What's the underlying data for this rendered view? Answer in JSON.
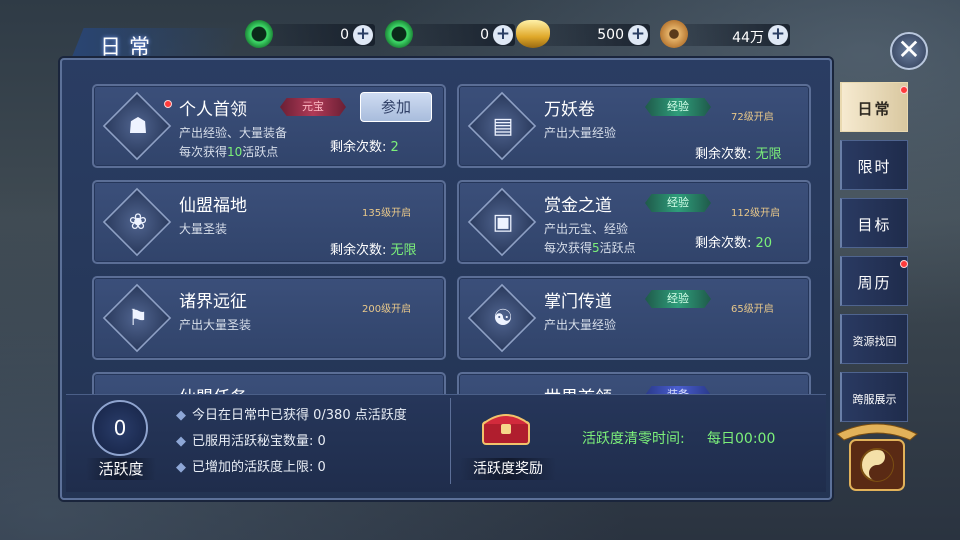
{
  "topbar": {
    "res1": {
      "value": "0",
      "icon": "green-swirl-icon"
    },
    "res2": {
      "value": "0",
      "icon": "green-swirl-icon"
    },
    "res3": {
      "value": "500",
      "icon": "gold-ingot-icon"
    },
    "res4": {
      "value": "44万",
      "icon": "copper-coin-icon"
    },
    "plus": "+"
  },
  "title": "日常",
  "close": "✕",
  "cards": [
    {
      "name": "个人首领",
      "tag": "元宝",
      "tag_color": "#b03a57",
      "desc1": "产出经验、大量装备",
      "desc2_pre": "每次获得",
      "desc2_num": "10",
      "desc2_post": "活跃点",
      "remain_label": "剩余次数:",
      "remain_value": "2",
      "button": "参加",
      "icon": "mask-icon"
    },
    {
      "name": "万妖卷",
      "tag": "经验",
      "tag_color": "#2f9d7b",
      "req": "72级开启",
      "desc1": "产出大量经验",
      "remain_label": "剩余次数:",
      "remain_value": "无限",
      "icon": "scroll-icon"
    },
    {
      "name": "仙盟福地",
      "req": "135级开启",
      "desc1": "大量圣装",
      "remain_label": "剩余次数:",
      "remain_value": "无限",
      "icon": "lotus-icon"
    },
    {
      "name": "赏金之道",
      "tag": "经验",
      "tag_color": "#2f9d7b",
      "req": "112级开启",
      "desc1": "产出元宝、经验",
      "desc2_pre": "每次获得",
      "desc2_num": "5",
      "desc2_post": "活跃点",
      "remain_label": "剩余次数:",
      "remain_value": "20",
      "icon": "treasure-box-icon"
    },
    {
      "name": "诸界远征",
      "req": "200级开启",
      "desc1": "产出大量圣装",
      "icon": "banner-icon"
    },
    {
      "name": "掌门传道",
      "tag": "经验",
      "tag_color": "#2f9d7b",
      "req": "65级开启",
      "desc1": "产出大量经验",
      "icon": "bagua-icon"
    },
    {
      "name": "仙盟任务"
    },
    {
      "name": "世界首领",
      "tag": "装备",
      "tag_color": "#4a5ed0"
    }
  ],
  "bottom": {
    "activity_value": "0",
    "activity_label": "活跃度",
    "lines": [
      "今日在日常中已获得 0/380 点活跃度",
      "已服用活跃秘宝数量:  0",
      "已增加的活跃度上限: 0"
    ],
    "reward_label": "活跃度奖励",
    "reset_label": "活跃度清零时间:",
    "reset_value": "每日00:00"
  },
  "tabs": [
    {
      "label": "日常",
      "active": true,
      "dot": true
    },
    {
      "label": "限时"
    },
    {
      "label": "目标"
    },
    {
      "label": "周历",
      "dot": true
    },
    {
      "label": "资源找回"
    },
    {
      "label": "跨服展示"
    }
  ]
}
